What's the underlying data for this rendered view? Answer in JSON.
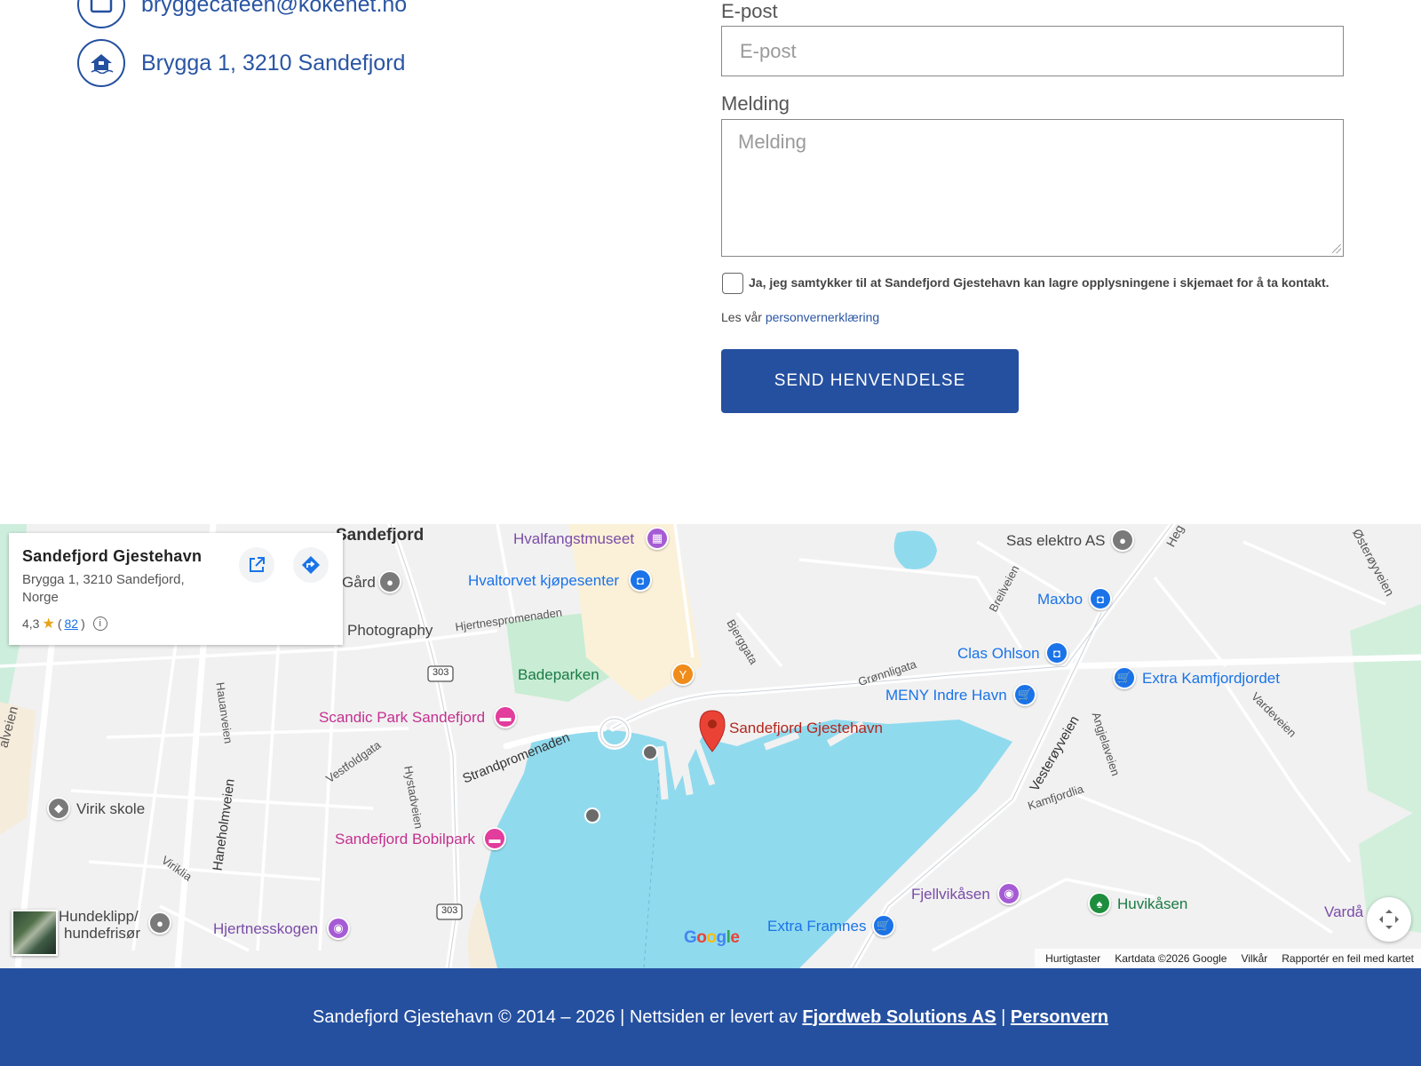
{
  "contact": {
    "email": "bryggecafeen@kokenet.no",
    "address": "Brygga 1, 3210 Sandefjord"
  },
  "form": {
    "email_label": "E-post",
    "email_placeholder": "E-post",
    "message_label": "Melding",
    "message_placeholder": "Melding",
    "consent_text": "Ja, jeg samtykker til at Sandefjord Gjestehavn kan lagre opplysningene i skjemaet for å ta kontakt.",
    "privacy_prefix": "Les vår",
    "privacy_link": "personvernerklæring",
    "submit_label": "SEND HENVENDELSE"
  },
  "map": {
    "card": {
      "name": "Sandefjord Gjestehavn",
      "address": "Brygga 1, 3210 Sandefjord, Norge",
      "rating": "4,3",
      "review_count_open": "(",
      "review_count": "82",
      "review_count_close": ")"
    },
    "labels": {
      "sandefjord": "Sandefjord",
      "hvalfangstmuseet": "Hvalfangstmuseet",
      "hvaltorvet": "Hvaltorvet kjøpesenter",
      "sas_elektro": "Sas elektro AS",
      "maxbo": "Maxbo",
      "clas_ohlson": "Clas Ohlson",
      "extra_kamfjordjordet": "Extra Kamfjordjordet",
      "meny": "MENY Indre Havn",
      "gard": "Gård",
      "photography": "Photography",
      "badeparken": "Badeparken",
      "scandic": "Scandic Park Sandefjord",
      "gjestehavn": "Sandefjord Gjestehavn",
      "virik_skole": "Virik skole",
      "bobilpark": "Sandefjord Bobilpark",
      "hundeklipp_1": "Hundeklipp/",
      "hundeklipp_2": "hundefrisør",
      "hjertnesskogen": "Hjertnesskogen",
      "fjellvikasen": "Fjellvikåsen",
      "huvikasen": "Huvikåsen",
      "extra_framnes": "Extra Framnes",
      "varda": "Vardå"
    },
    "streets": {
      "hjertnespromenaden": "Hjertnespromenaden",
      "strandpromenaden": "Strandpromenaden",
      "bjerggata": "Bjerggata",
      "gronnligata": "Grønnligata",
      "breilveien": "Breilveien",
      "osteroyveien": "Østerøyveien",
      "hegg": "Heg",
      "vardeveien": "Vardeveien",
      "vesteroyveien": "Vesterøyveien",
      "angjelaveien": "Angjelaveien",
      "kamfjordlia": "Kamfjordlia",
      "hauanveien": "Hauanveien",
      "vestfoldgata": "Vestfoldgata",
      "hystadveien": "Hystadveien",
      "haneholmveien": "Haneholmveien",
      "viriklia": "Viriklia",
      "alveien": "alveien",
      "road_303_a": "303",
      "road_303_b": "303"
    },
    "google_logo": "Google",
    "attribution": {
      "shortcuts": "Hurtigtaster",
      "map_data": "Kartdata ©2026 Google",
      "terms": "Vilkår",
      "report": "Rapportér en feil med kartet"
    }
  },
  "footer": {
    "text": "Sandefjord Gjestehavn © 2014 – 2026 | Nettsiden er levert av",
    "company_link": "Fjordweb Solutions AS",
    "separator": "|",
    "privacy_link": "Personvern"
  },
  "colors": {
    "brand_blue": "#2550a0",
    "link_blue": "#2a55a3",
    "water": "#90daee"
  }
}
